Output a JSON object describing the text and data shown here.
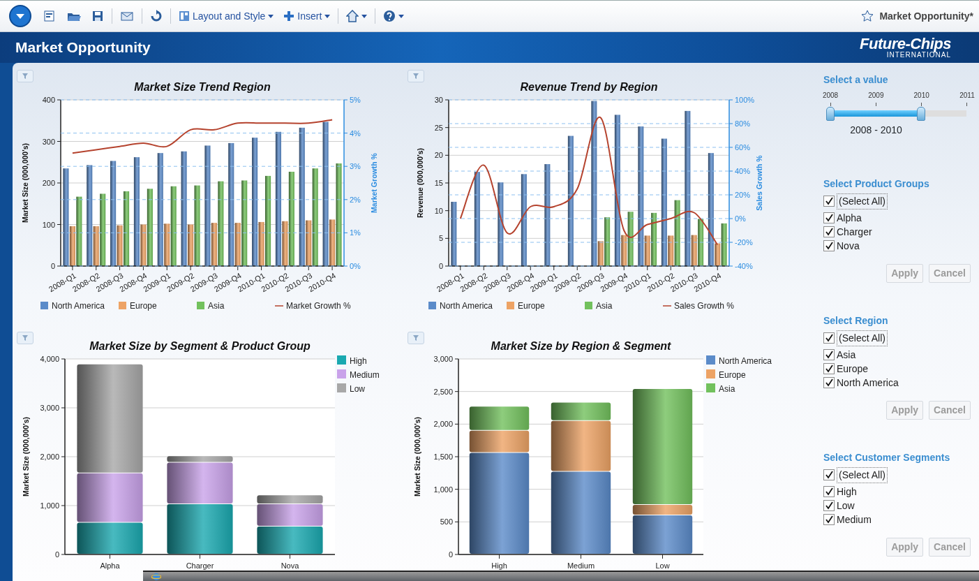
{
  "toolbar": {
    "menus": [
      "Layout and Style",
      "Insert"
    ],
    "document_title": "Market Opportunity*"
  },
  "header": {
    "title": "Market Opportunity",
    "logo": {
      "wordmark": "Future-Chips",
      "subtitle": "INTERNATIONAL"
    }
  },
  "charts": [
    {
      "chart_data": {
        "type": "bar",
        "title": "Market Size Trend Region",
        "ylabel": "Market Size (000,000's)",
        "grid": true,
        "legend": "bottom",
        "categories": [
          "2008-Q1",
          "2008-Q2",
          "2008-Q3",
          "2008-Q4",
          "2009-Q1",
          "2009-Q2",
          "2009-Q3",
          "2009-Q4",
          "2010-Q1",
          "2010-Q2",
          "2010-Q3",
          "2010-Q4"
        ],
        "ylim": [
          0,
          400
        ],
        "yticks": [
          0,
          100,
          200,
          300,
          400
        ],
        "series": [
          {
            "name": "North America",
            "color": "#5b8bc9",
            "values": [
              235,
              243,
              253,
              262,
              272,
              276,
              290,
              296,
              309,
              323,
              333,
              347
            ]
          },
          {
            "name": "Europe",
            "color": "#eda365",
            "values": [
              96,
              96,
              98,
              100,
              102,
              100,
              104,
              104,
              106,
              108,
              110,
              112
            ]
          },
          {
            "name": "Asia",
            "color": "#72c15d",
            "values": [
              167,
              174,
              180,
              186,
              192,
              194,
              204,
              206,
              217,
              227,
              235,
              247
            ]
          }
        ]
      },
      "overlay": {
        "chart_data": {
          "type": "line",
          "ylabel": "Market Growth %",
          "grid": true,
          "legend": "bottom",
          "ylim": [
            0,
            5
          ],
          "yticks": [
            {
              "value": 0,
              "label": "0%"
            },
            {
              "value": 1,
              "label": "1%"
            },
            {
              "value": 2,
              "label": "2%"
            },
            {
              "value": 3,
              "label": "3%"
            },
            {
              "value": 4,
              "label": "4%"
            },
            {
              "value": 5,
              "label": "5%"
            }
          ],
          "series": [
            {
              "name": "Market Growth %",
              "color": "#b5432e",
              "values": [
                3.4,
                3.5,
                3.6,
                3.7,
                3.6,
                4.1,
                4.1,
                4.3,
                4.3,
                4.3,
                4.3,
                4.4
              ]
            }
          ]
        }
      }
    },
    {
      "chart_data": {
        "type": "bar",
        "title": "Revenue Trend by Region",
        "ylabel": "Revenue (000,000's)",
        "grid": true,
        "legend": "bottom",
        "categories": [
          "2008-Q1",
          "2008-Q2",
          "2008-Q3",
          "2008-Q4",
          "2009-Q1",
          "2009-Q2",
          "2009-Q3",
          "2009-Q4",
          "2010-Q1",
          "2010-Q2",
          "2010-Q3",
          "2010-Q4"
        ],
        "ylim": [
          0,
          30
        ],
        "yticks": [
          0,
          5,
          10,
          15,
          20,
          25,
          30
        ],
        "series": [
          {
            "name": "North America",
            "color": "#5b8bc9",
            "values": [
              11.6,
              17,
              15.1,
              16.6,
              18.4,
              23.5,
              29.8,
              27.3,
              25.2,
              23,
              28,
              20.4
            ]
          },
          {
            "name": "Europe",
            "color": "#eda365",
            "values": [
              null,
              null,
              null,
              null,
              null,
              null,
              4.5,
              5.6,
              5.5,
              5.5,
              5.6,
              4.1
            ]
          },
          {
            "name": "Asia",
            "color": "#72c15d",
            "values": [
              null,
              null,
              null,
              null,
              null,
              null,
              8.8,
              9.8,
              9.6,
              11.9,
              8.5,
              7.7
            ]
          }
        ]
      },
      "overlay": {
        "chart_data": {
          "type": "line",
          "ylabel": "Sales Growth %",
          "grid": true,
          "legend": "bottom",
          "ylim": [
            -40,
            100
          ],
          "yticks": [
            {
              "value": -40,
              "label": "-40%"
            },
            {
              "value": -20,
              "label": "-20%"
            },
            {
              "value": 0,
              "label": "0%"
            },
            {
              "value": 20,
              "label": "20%"
            },
            {
              "value": 40,
              "label": "40%"
            },
            {
              "value": 60,
              "label": "60%"
            },
            {
              "value": 80,
              "label": "80%"
            },
            {
              "value": 100,
              "label": "100%"
            }
          ],
          "series": [
            {
              "name": "Sales Growth %",
              "color": "#b5432e",
              "values": [
                0,
                45,
                -12,
                10,
                10,
                25,
                85,
                -10,
                -5,
                0,
                5,
                -22
              ]
            }
          ]
        }
      }
    },
    {
      "chart_data": {
        "type": "bar",
        "stacked": true,
        "title": "Market Size by Segment & Product Group",
        "ylabel": "Market Size (000,000's)",
        "grid": true,
        "legend": "right",
        "categories": [
          "Alpha",
          "Charger",
          "Nova"
        ],
        "ylim": [
          0,
          4000
        ],
        "yticks": [
          {
            "value": 0,
            "label": "0"
          },
          {
            "value": 1000,
            "label": "1,000"
          },
          {
            "value": 2000,
            "label": "2,000"
          },
          {
            "value": 3000,
            "label": "3,000"
          },
          {
            "value": 4000,
            "label": "4,000"
          }
        ],
        "series": [
          {
            "name": "High",
            "color": "#1aa9b0",
            "values": [
              650,
              1030,
              570
            ]
          },
          {
            "name": "Medium",
            "color": "#c9a2ea",
            "values": [
              1010,
              850,
              460
            ]
          },
          {
            "name": "Low",
            "color": "#a8a8a8",
            "values": [
              2230,
              130,
              180
            ]
          }
        ]
      }
    },
    {
      "chart_data": {
        "type": "bar",
        "stacked": true,
        "title": "Market Size by Region & Segment",
        "ylabel": "Market Size (000,000's)",
        "grid": true,
        "legend": "right",
        "categories": [
          "High",
          "Medium",
          "Low"
        ],
        "ylim": [
          0,
          3000
        ],
        "yticks": [
          {
            "value": 0,
            "label": "0"
          },
          {
            "value": 500,
            "label": "500"
          },
          {
            "value": 1000,
            "label": "1,000"
          },
          {
            "value": 1500,
            "label": "1,500"
          },
          {
            "value": 2000,
            "label": "2,000"
          },
          {
            "value": 2500,
            "label": "2,500"
          },
          {
            "value": 3000,
            "label": "3,000"
          }
        ],
        "series": [
          {
            "name": "North America",
            "color": "#5b8bc9",
            "values": [
              1560,
              1270,
              600
            ]
          },
          {
            "name": "Europe",
            "color": "#eda365",
            "values": [
              340,
              780,
              160
            ]
          },
          {
            "name": "Asia",
            "color": "#72c15d",
            "values": [
              370,
              280,
              1780
            ]
          }
        ]
      }
    }
  ],
  "filters": {
    "slider": {
      "title": "Select a value",
      "ticks": [
        "2008",
        "2009",
        "2010",
        "2011"
      ],
      "level": 0.667,
      "reading": "2008 - 2010"
    },
    "groups": [
      {
        "title": "Select Product Groups",
        "select_all": {
          "label": "(Select All)",
          "checked": true
        },
        "items": [
          {
            "label": "Alpha",
            "checked": true
          },
          {
            "label": "Charger",
            "checked": true
          },
          {
            "label": "Nova",
            "checked": true
          }
        ],
        "buttons": [
          {
            "label": "Apply",
            "disabled": true
          },
          {
            "label": "Cancel",
            "disabled": true
          }
        ]
      },
      {
        "title": "Select Region",
        "select_all": {
          "label": "(Select All)",
          "checked": true
        },
        "items": [
          {
            "label": "Asia",
            "checked": true
          },
          {
            "label": "Europe",
            "checked": true
          },
          {
            "label": "North America",
            "checked": true
          }
        ],
        "buttons": [
          {
            "label": "Apply",
            "disabled": true
          },
          {
            "label": "Cancel",
            "disabled": true
          }
        ]
      },
      {
        "title": "Select Customer Segments",
        "select_all": {
          "label": "(Select All)",
          "checked": true
        },
        "items": [
          {
            "label": "High",
            "checked": true
          },
          {
            "label": "Low",
            "checked": true
          },
          {
            "label": "Medium",
            "checked": true
          }
        ],
        "buttons": [
          {
            "label": "Apply",
            "disabled": true
          },
          {
            "label": "Cancel",
            "disabled": true
          }
        ]
      }
    ]
  }
}
